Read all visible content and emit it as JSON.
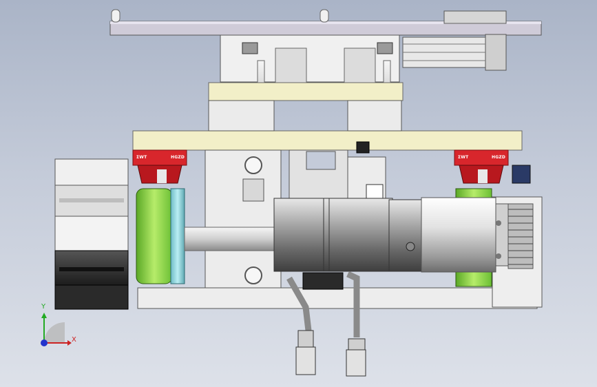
{
  "viewport": {
    "rail_left_label_a": "ΣWT",
    "rail_left_label_b": "HGZD",
    "rail_right_label_a": "ΣWT",
    "rail_right_label_b": "HGZD",
    "triad": {
      "x_label": "X",
      "y_label": "Y"
    }
  },
  "colors": {
    "background_top": "#aab4c7",
    "background_bottom": "#dde1e9",
    "rail_red": "#d8262c",
    "cream_plate": "#f2efc8",
    "green_pulley": "#9ad84a",
    "cyan_ring": "#8fd6de",
    "triad_x": "#cc2222",
    "triad_y": "#22aa22",
    "triad_z": "#2233cc"
  }
}
